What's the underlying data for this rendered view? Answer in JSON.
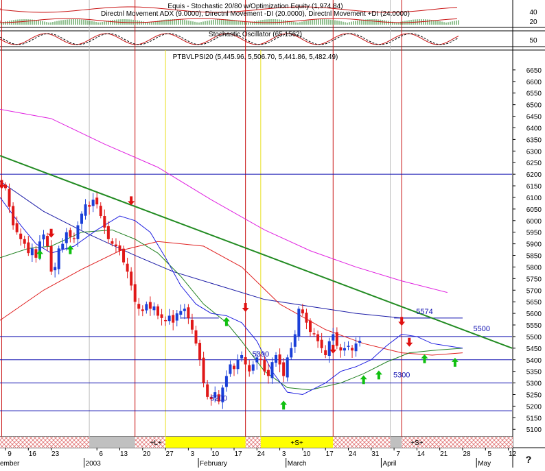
{
  "indicator_panel": {
    "title_line1": "Equis - Stochastic 20/80 w/Optimization Equity (1,974.84)",
    "title_line2": "Directnl Movement ADX (9.0000), Directnl Movement -DI (20.0000), Directnl Movement +DI (24.0000)",
    "stochastic_title": "Stochastic Oscillator (65.1562)",
    "axis_labels": [
      "40",
      "20",
      "50"
    ]
  },
  "price_title": "PTBVLPSI20 (5,445.96, 5,506.70, 5,441.86, 5,482.49)",
  "price_labels": [
    {
      "text": "5574",
      "price": 5574,
      "day": 110
    },
    {
      "text": "5500",
      "price": 5500,
      "day": 125
    },
    {
      "text": "5390",
      "price": 5390,
      "day": 67
    },
    {
      "text": "5300",
      "price": 5300,
      "day": 104
    },
    {
      "text": "5200",
      "price": 5200,
      "day": 56
    }
  ],
  "signal_band": {
    "labels": [
      {
        "text": "+L+",
        "day": 39.5
      },
      {
        "text": "+S+",
        "day": 76.5
      },
      {
        "text": "+S+",
        "day": 108
      }
    ]
  },
  "x_axis": {
    "day_ticks": [
      {
        "label": "9",
        "day": 0
      },
      {
        "label": "16",
        "day": 6
      },
      {
        "label": "23",
        "day": 12
      },
      {
        "label": "6",
        "day": 24
      },
      {
        "label": "13",
        "day": 30
      },
      {
        "label": "20",
        "day": 36
      },
      {
        "label": "27",
        "day": 42
      },
      {
        "label": "3",
        "day": 48
      },
      {
        "label": "10",
        "day": 54
      },
      {
        "label": "17",
        "day": 60
      },
      {
        "label": "24",
        "day": 66
      },
      {
        "label": "3",
        "day": 72
      },
      {
        "label": "10",
        "day": 78
      },
      {
        "label": "17",
        "day": 84
      },
      {
        "label": "24",
        "day": 90
      },
      {
        "label": "31",
        "day": 96
      },
      {
        "label": "7",
        "day": 102
      },
      {
        "label": "14",
        "day": 108
      },
      {
        "label": "21",
        "day": 114
      },
      {
        "label": "28",
        "day": 120
      },
      {
        "label": "5",
        "day": 126
      },
      {
        "label": "12",
        "day": 132
      }
    ],
    "month_labels": [
      {
        "label": "ember",
        "day": -2
      },
      {
        "label": "2003",
        "day": 21
      },
      {
        "label": "February",
        "day": 51
      },
      {
        "label": "March",
        "day": 74
      },
      {
        "label": "April",
        "day": 99
      },
      {
        "label": "May",
        "day": 124
      }
    ],
    "corner_mark": "?"
  },
  "chart_data": {
    "type": "candlestick",
    "title": "PTBVLPSI20 (5,445.96, 5,506.70, 5,441.86, 5,482.49)",
    "y_ticks": [
      5100,
      5150,
      5200,
      5250,
      5300,
      5350,
      5400,
      5450,
      5500,
      5550,
      5600,
      5650,
      5700,
      5750,
      5800,
      5850,
      5900,
      5950,
      6000,
      6050,
      6100,
      6150,
      6200,
      6250,
      6300,
      6350,
      6400,
      6450,
      6500,
      6550,
      6600,
      6650
    ],
    "y_range": [
      5080,
      6700
    ],
    "x_range_days": [
      -2,
      136
    ],
    "closes": [
      6140,
      6060,
      5980,
      5950,
      5920,
      5900,
      5860,
      5880,
      5840,
      5910,
      5940,
      5890,
      5780,
      5800,
      5880,
      5900,
      5950,
      5930,
      5920,
      5980,
      6030,
      6070,
      6060,
      6090,
      6070,
      6020,
      5970,
      5920,
      5900,
      5890,
      5870,
      5820,
      5780,
      5720,
      5650,
      5620,
      5610,
      5640,
      5620,
      5630,
      5590,
      5580,
      5570,
      5590,
      5560,
      5600,
      5610,
      5620,
      5580,
      5530,
      5470,
      5400,
      5300,
      5240,
      5230,
      5260,
      5220,
      5280,
      5330,
      5380,
      5360,
      5400,
      5420,
      5380,
      5350,
      5380,
      5410,
      5400,
      5350,
      5330,
      5390,
      5420,
      5380,
      5330,
      5410,
      5450,
      5510,
      5620,
      5600,
      5560,
      5520,
      5510,
      5480,
      5450,
      5420,
      5480,
      5510,
      5460,
      5440,
      5450,
      5460,
      5440,
      5470,
      5482
    ],
    "series": [
      {
        "name": "",
        "role": "ma-blue",
        "color": "#1a1aa6",
        "points": [
          [
            -2,
            6170
          ],
          [
            10,
            6040
          ],
          [
            22,
            5940
          ],
          [
            34,
            5850
          ],
          [
            44,
            5780
          ],
          [
            56,
            5720
          ],
          [
            68,
            5660
          ],
          [
            80,
            5630
          ],
          [
            92,
            5600
          ],
          [
            104,
            5580
          ],
          [
            112,
            5580
          ]
        ]
      },
      {
        "name": "",
        "role": "ma-magenta",
        "color": "#e020e0",
        "points": [
          [
            -2,
            6480
          ],
          [
            12,
            6440
          ],
          [
            26,
            6330
          ],
          [
            40,
            6230
          ],
          [
            54,
            6090
          ],
          [
            68,
            5960
          ],
          [
            80,
            5870
          ],
          [
            92,
            5800
          ],
          [
            104,
            5740
          ],
          [
            116,
            5690
          ]
        ]
      },
      {
        "name": "",
        "role": "ma-red",
        "color": "#e02020",
        "points": [
          [
            -2,
            5570
          ],
          [
            10,
            5700
          ],
          [
            20,
            5790
          ],
          [
            30,
            5870
          ],
          [
            40,
            5910
          ],
          [
            52,
            5890
          ],
          [
            62,
            5800
          ],
          [
            72,
            5640
          ],
          [
            84,
            5530
          ],
          [
            94,
            5470
          ],
          [
            104,
            5430
          ],
          [
            112,
            5420
          ],
          [
            120,
            5430
          ]
        ]
      },
      {
        "name": "",
        "role": "ma-green",
        "color": "#208020",
        "points": [
          [
            -2,
            5840
          ],
          [
            6,
            5880
          ],
          [
            12,
            5890
          ],
          [
            20,
            5950
          ],
          [
            28,
            5960
          ],
          [
            34,
            5920
          ],
          [
            40,
            5860
          ],
          [
            46,
            5760
          ],
          [
            52,
            5640
          ],
          [
            58,
            5560
          ],
          [
            62,
            5480
          ],
          [
            68,
            5350
          ],
          [
            74,
            5280
          ],
          [
            80,
            5270
          ],
          [
            88,
            5300
          ],
          [
            94,
            5340
          ],
          [
            100,
            5390
          ],
          [
            106,
            5430
          ],
          [
            112,
            5440
          ],
          [
            120,
            5450
          ]
        ]
      },
      {
        "name": "",
        "role": "fast-blue",
        "color": "#2020e0",
        "points": [
          [
            -2,
            6100
          ],
          [
            4,
            5980
          ],
          [
            8,
            5900
          ],
          [
            12,
            5860
          ],
          [
            18,
            5890
          ],
          [
            24,
            5960
          ],
          [
            30,
            6020
          ],
          [
            34,
            6000
          ],
          [
            38,
            5950
          ],
          [
            42,
            5840
          ],
          [
            46,
            5720
          ],
          [
            50,
            5640
          ],
          [
            54,
            5600
          ],
          [
            58,
            5590
          ],
          [
            62,
            5560
          ],
          [
            66,
            5480
          ],
          [
            70,
            5350
          ],
          [
            74,
            5260
          ],
          [
            78,
            5250
          ],
          [
            84,
            5300
          ],
          [
            88,
            5350
          ],
          [
            92,
            5370
          ],
          [
            96,
            5400
          ],
          [
            100,
            5460
          ],
          [
            104,
            5510
          ],
          [
            108,
            5500
          ],
          [
            112,
            5470
          ],
          [
            116,
            5460
          ],
          [
            120,
            5450
          ]
        ]
      }
    ],
    "trendline": {
      "role": "resistance",
      "color": "#228b22",
      "points": [
        [
          -2,
          6280
        ],
        [
          134,
          5450
        ]
      ]
    },
    "horizontal_lines": [
      6200,
      5500,
      5400,
      5300,
      5180
    ],
    "short_levels": [
      {
        "price": 5580,
        "from_day": 102,
        "to_day": 120
      },
      {
        "price": 5580,
        "from_day": 46,
        "to_day": 56
      }
    ],
    "red_markers": [
      -1,
      34,
      63,
      86,
      104
    ],
    "yellow_markers": [
      42,
      67
    ],
    "gray_markers": [
      22,
      101
    ],
    "buy_arrows": [
      {
        "day": 9,
        "price": 5850
      },
      {
        "day": 17,
        "price": 5870
      },
      {
        "day": 58,
        "price": 5560
      },
      {
        "day": 73,
        "price": 5200
      },
      {
        "day": 94,
        "price": 5310
      },
      {
        "day": 98,
        "price": 5330
      },
      {
        "day": 110,
        "price": 5400
      },
      {
        "day": 118,
        "price": 5385
      }
    ],
    "sell_arrows": [
      {
        "day": -1,
        "price": 6160
      },
      {
        "day": 12,
        "price": 5950
      },
      {
        "day": 33,
        "price": 6090
      },
      {
        "day": 63,
        "price": 5630
      },
      {
        "day": 86,
        "price": 5450
      },
      {
        "day": 104,
        "price": 5570
      },
      {
        "day": 106,
        "price": 5480
      }
    ]
  }
}
